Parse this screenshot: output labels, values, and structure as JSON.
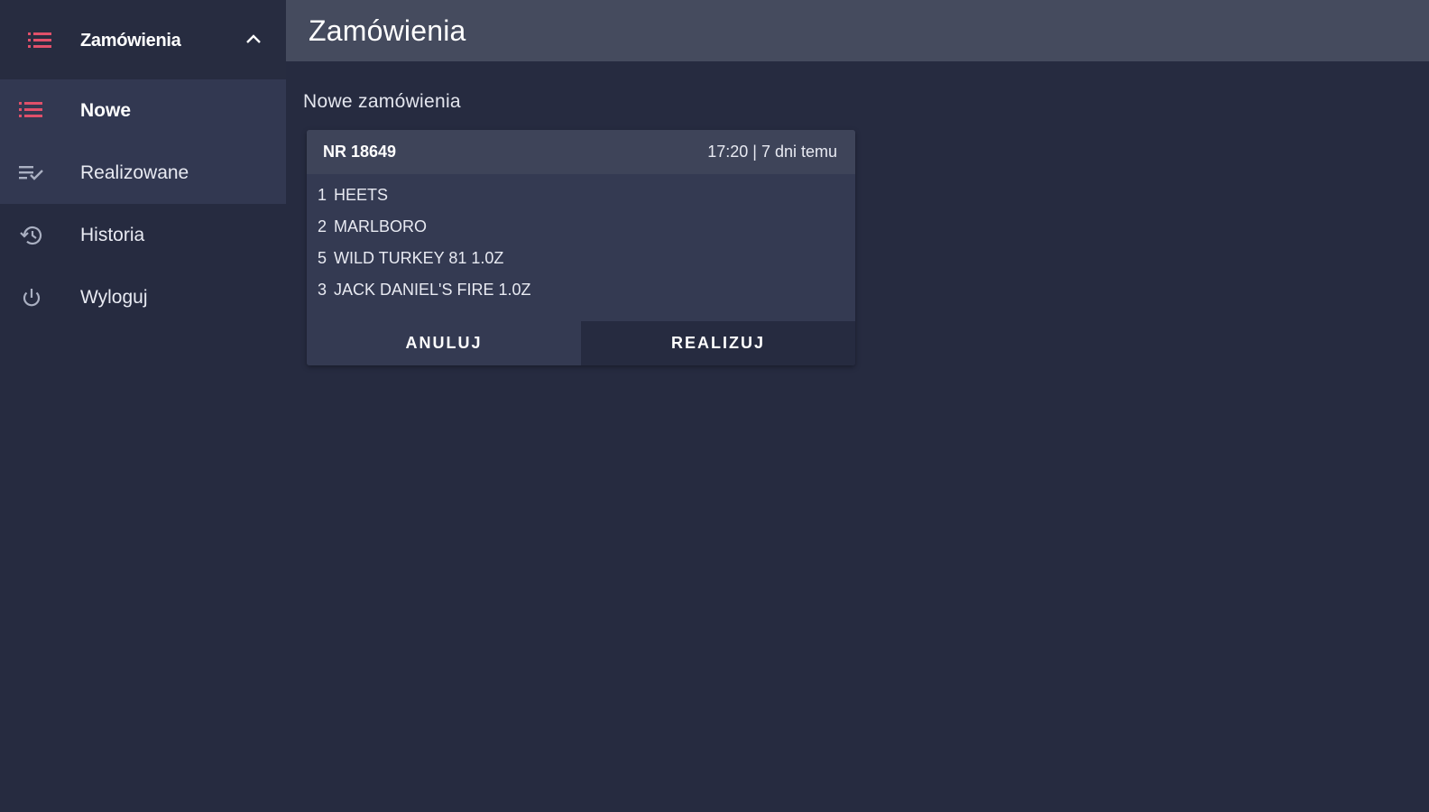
{
  "colors": {
    "accent": "#e0506a",
    "background": "#262b40",
    "topbar": "#454b5e",
    "card": "#343a52"
  },
  "sidebar": {
    "header": {
      "title": "Zamówienia",
      "icon": "list-icon",
      "toggle_icon": "chevron-up-icon"
    },
    "items": [
      {
        "label": "Nowe",
        "icon": "list-icon",
        "active": true
      },
      {
        "label": "Realizowane",
        "icon": "playlist-check-icon",
        "active": false
      },
      {
        "label": "Historia",
        "icon": "history-icon",
        "active": false
      },
      {
        "label": "Wyloguj",
        "icon": "power-icon",
        "active": false
      }
    ]
  },
  "header": {
    "title": "Zamówienia"
  },
  "main": {
    "section_title": "Nowe zamówienia",
    "order": {
      "number": "NR 18649",
      "time": "17:20 | 7 dni temu",
      "items": [
        {
          "qty": "1",
          "name": "HEETS"
        },
        {
          "qty": "2",
          "name": "MARLBORO"
        },
        {
          "qty": "5",
          "name": "WILD TURKEY 81 1.0Z"
        },
        {
          "qty": "3",
          "name": "JACK DANIEL'S FIRE 1.0Z"
        }
      ],
      "cancel_label": "ANULUJ",
      "confirm_label": "REALIZUJ"
    }
  }
}
